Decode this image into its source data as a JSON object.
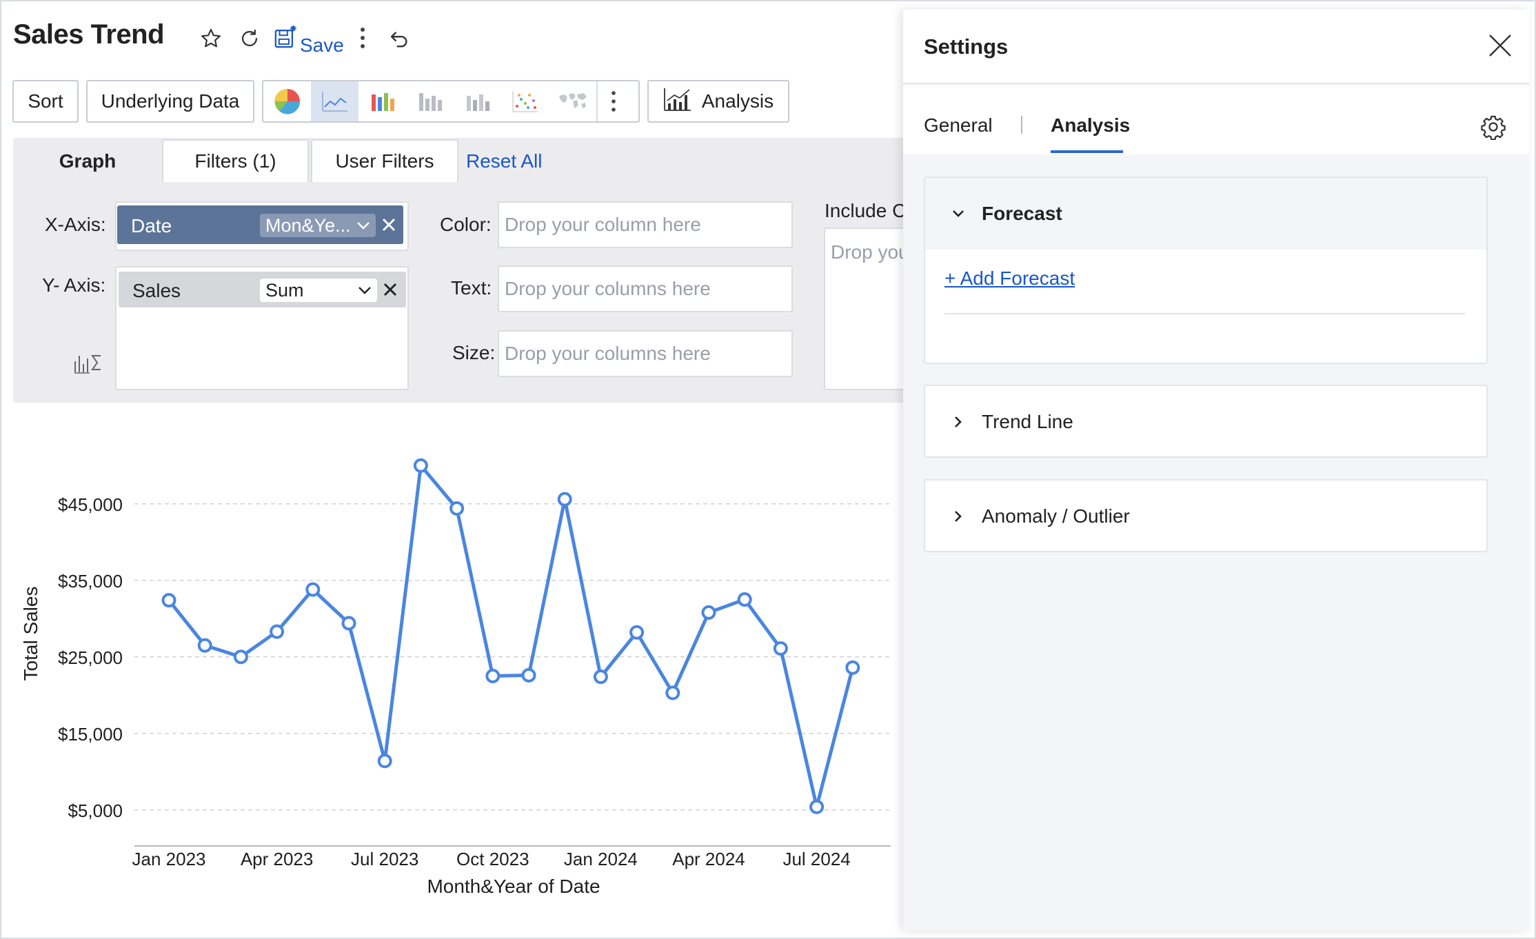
{
  "header": {
    "title": "Sales Trend",
    "save_label": "Save",
    "icons": [
      "star-icon",
      "refresh-icon",
      "save-icon",
      "more-vertical-icon",
      "undo-icon"
    ]
  },
  "toolbar": {
    "sort_label": "Sort",
    "underlying_data_label": "Underlying Data",
    "analysis_label": "Analysis",
    "chart_types": [
      "pie",
      "line",
      "bar",
      "stacked-bar",
      "stacked-bar-alt",
      "scatter",
      "map"
    ],
    "active_chart_type": "line"
  },
  "tabs": {
    "graph": "Graph",
    "filters": "Filters  (1)",
    "user_filters": "User Filters",
    "reset_all": "Reset All"
  },
  "shelf": {
    "x_axis_label": "X-Axis:",
    "y_axis_label": "Y- Axis:",
    "x_field": "Date",
    "x_agg": "Mon&Ye...",
    "y_field": "Sales",
    "y_agg": "Sum",
    "color_label": "Color:",
    "color_placeholder": "Drop your column here",
    "text_label": "Text:",
    "text_placeholder": "Drop your columns here",
    "size_label": "Size:",
    "size_placeholder": "Drop your columns here",
    "include_label": "Include C",
    "include_placeholder": "Drop you"
  },
  "chart_data": {
    "type": "line",
    "title": "",
    "xlabel": "Month&Year of Date",
    "ylabel": "Total Sales",
    "x_tick_labels": [
      "Jan 2023",
      "Apr 2023",
      "Jul 2023",
      "Oct 2023",
      "Jan 2024",
      "Apr 2024",
      "Jul 2024"
    ],
    "y_tick_labels": [
      "$5,000",
      "$15,000",
      "$25,000",
      "$35,000",
      "$45,000"
    ],
    "y_ticks": [
      5000,
      15000,
      25000,
      35000,
      45000
    ],
    "ylim": [
      3000,
      53000
    ],
    "grid": true,
    "legend": "none",
    "line_color": "#4a86e0",
    "categories": [
      "Jan 2023",
      "Feb 2023",
      "Mar 2023",
      "Apr 2023",
      "May 2023",
      "Jun 2023",
      "Jul 2023",
      "Aug 2023",
      "Sep 2023",
      "Oct 2023",
      "Nov 2023",
      "Dec 2023",
      "Jan 2024",
      "Feb 2024",
      "Mar 2024",
      "Apr 2024",
      "May 2024",
      "Jun 2024",
      "Jul 2024",
      "Aug 2024"
    ],
    "values": [
      32400,
      26500,
      25000,
      28300,
      33800,
      29400,
      11400,
      50000,
      44400,
      22500,
      22600,
      45600,
      22400,
      28200,
      20300,
      30800,
      32500,
      26100,
      5400,
      23600
    ]
  },
  "settings": {
    "title": "Settings",
    "tab_general": "General",
    "tab_analysis": "Analysis",
    "active_tab": "Analysis",
    "forecast_label": "Forecast",
    "add_forecast_label": "+ Add Forecast",
    "trend_line_label": "Trend Line",
    "anomaly_label": "Anomaly / Outlier"
  }
}
